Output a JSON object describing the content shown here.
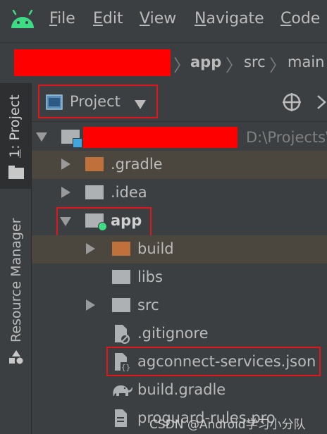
{
  "menubar": {
    "items": [
      {
        "label": "File",
        "mnemonic": "F",
        "rest": "ile"
      },
      {
        "label": "Edit",
        "mnemonic": "E",
        "rest": "dit"
      },
      {
        "label": "View",
        "mnemonic": "V",
        "rest": "iew"
      },
      {
        "label": "Navigate",
        "mnemonic": "N",
        "rest": "avigate"
      },
      {
        "label": "Code",
        "mnemonic": "C",
        "rest": "ode"
      }
    ]
  },
  "breadcrumb": {
    "items": [
      "app",
      "src",
      "main"
    ]
  },
  "left_strip": {
    "project_tab": "1: Project",
    "resource_manager_tab": "Resource Manager"
  },
  "project_panel": {
    "view_selector": "Project",
    "root_path": "D:\\Projects\\",
    "tree": [
      {
        "label": ".gradle",
        "expanded": false,
        "type": "folder-orange"
      },
      {
        "label": ".idea",
        "expanded": false,
        "type": "folder"
      },
      {
        "label": "app",
        "expanded": true,
        "type": "module"
      },
      {
        "label": "build",
        "expanded": false,
        "type": "folder-orange"
      },
      {
        "label": "libs",
        "type": "folder"
      },
      {
        "label": "src",
        "expanded": false,
        "type": "folder"
      },
      {
        "label": ".gitignore",
        "type": "file-ignore"
      },
      {
        "label": "agconnect-services.json",
        "type": "file-json"
      },
      {
        "label": "build.gradle",
        "type": "file-gradle"
      },
      {
        "label": "proguard-rules.pro",
        "type": "file"
      }
    ]
  },
  "watermark": "CSDN @Android学习小分队",
  "colors": {
    "background": "#3c3f41",
    "highlight_box": "#e0161b",
    "redaction": "#ff0000",
    "android_green": "#3ddc84",
    "selected_row": "#4b473e"
  }
}
